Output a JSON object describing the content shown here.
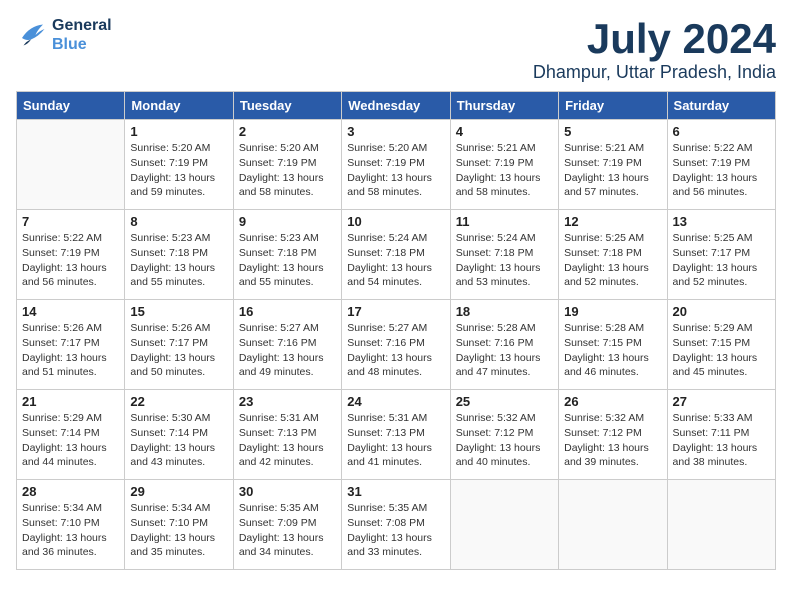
{
  "header": {
    "logo_line1": "General",
    "logo_line2": "Blue",
    "title": "July 2024",
    "subtitle": "Dhampur, Uttar Pradesh, India"
  },
  "columns": [
    "Sunday",
    "Monday",
    "Tuesday",
    "Wednesday",
    "Thursday",
    "Friday",
    "Saturday"
  ],
  "weeks": [
    [
      {
        "day": "",
        "info": ""
      },
      {
        "day": "1",
        "info": "Sunrise: 5:20 AM\nSunset: 7:19 PM\nDaylight: 13 hours\nand 59 minutes."
      },
      {
        "day": "2",
        "info": "Sunrise: 5:20 AM\nSunset: 7:19 PM\nDaylight: 13 hours\nand 58 minutes."
      },
      {
        "day": "3",
        "info": "Sunrise: 5:20 AM\nSunset: 7:19 PM\nDaylight: 13 hours\nand 58 minutes."
      },
      {
        "day": "4",
        "info": "Sunrise: 5:21 AM\nSunset: 7:19 PM\nDaylight: 13 hours\nand 58 minutes."
      },
      {
        "day": "5",
        "info": "Sunrise: 5:21 AM\nSunset: 7:19 PM\nDaylight: 13 hours\nand 57 minutes."
      },
      {
        "day": "6",
        "info": "Sunrise: 5:22 AM\nSunset: 7:19 PM\nDaylight: 13 hours\nand 56 minutes."
      }
    ],
    [
      {
        "day": "7",
        "info": "Sunrise: 5:22 AM\nSunset: 7:19 PM\nDaylight: 13 hours\nand 56 minutes."
      },
      {
        "day": "8",
        "info": "Sunrise: 5:23 AM\nSunset: 7:18 PM\nDaylight: 13 hours\nand 55 minutes."
      },
      {
        "day": "9",
        "info": "Sunrise: 5:23 AM\nSunset: 7:18 PM\nDaylight: 13 hours\nand 55 minutes."
      },
      {
        "day": "10",
        "info": "Sunrise: 5:24 AM\nSunset: 7:18 PM\nDaylight: 13 hours\nand 54 minutes."
      },
      {
        "day": "11",
        "info": "Sunrise: 5:24 AM\nSunset: 7:18 PM\nDaylight: 13 hours\nand 53 minutes."
      },
      {
        "day": "12",
        "info": "Sunrise: 5:25 AM\nSunset: 7:18 PM\nDaylight: 13 hours\nand 52 minutes."
      },
      {
        "day": "13",
        "info": "Sunrise: 5:25 AM\nSunset: 7:17 PM\nDaylight: 13 hours\nand 52 minutes."
      }
    ],
    [
      {
        "day": "14",
        "info": "Sunrise: 5:26 AM\nSunset: 7:17 PM\nDaylight: 13 hours\nand 51 minutes."
      },
      {
        "day": "15",
        "info": "Sunrise: 5:26 AM\nSunset: 7:17 PM\nDaylight: 13 hours\nand 50 minutes."
      },
      {
        "day": "16",
        "info": "Sunrise: 5:27 AM\nSunset: 7:16 PM\nDaylight: 13 hours\nand 49 minutes."
      },
      {
        "day": "17",
        "info": "Sunrise: 5:27 AM\nSunset: 7:16 PM\nDaylight: 13 hours\nand 48 minutes."
      },
      {
        "day": "18",
        "info": "Sunrise: 5:28 AM\nSunset: 7:16 PM\nDaylight: 13 hours\nand 47 minutes."
      },
      {
        "day": "19",
        "info": "Sunrise: 5:28 AM\nSunset: 7:15 PM\nDaylight: 13 hours\nand 46 minutes."
      },
      {
        "day": "20",
        "info": "Sunrise: 5:29 AM\nSunset: 7:15 PM\nDaylight: 13 hours\nand 45 minutes."
      }
    ],
    [
      {
        "day": "21",
        "info": "Sunrise: 5:29 AM\nSunset: 7:14 PM\nDaylight: 13 hours\nand 44 minutes."
      },
      {
        "day": "22",
        "info": "Sunrise: 5:30 AM\nSunset: 7:14 PM\nDaylight: 13 hours\nand 43 minutes."
      },
      {
        "day": "23",
        "info": "Sunrise: 5:31 AM\nSunset: 7:13 PM\nDaylight: 13 hours\nand 42 minutes."
      },
      {
        "day": "24",
        "info": "Sunrise: 5:31 AM\nSunset: 7:13 PM\nDaylight: 13 hours\nand 41 minutes."
      },
      {
        "day": "25",
        "info": "Sunrise: 5:32 AM\nSunset: 7:12 PM\nDaylight: 13 hours\nand 40 minutes."
      },
      {
        "day": "26",
        "info": "Sunrise: 5:32 AM\nSunset: 7:12 PM\nDaylight: 13 hours\nand 39 minutes."
      },
      {
        "day": "27",
        "info": "Sunrise: 5:33 AM\nSunset: 7:11 PM\nDaylight: 13 hours\nand 38 minutes."
      }
    ],
    [
      {
        "day": "28",
        "info": "Sunrise: 5:34 AM\nSunset: 7:10 PM\nDaylight: 13 hours\nand 36 minutes."
      },
      {
        "day": "29",
        "info": "Sunrise: 5:34 AM\nSunset: 7:10 PM\nDaylight: 13 hours\nand 35 minutes."
      },
      {
        "day": "30",
        "info": "Sunrise: 5:35 AM\nSunset: 7:09 PM\nDaylight: 13 hours\nand 34 minutes."
      },
      {
        "day": "31",
        "info": "Sunrise: 5:35 AM\nSunset: 7:08 PM\nDaylight: 13 hours\nand 33 minutes."
      },
      {
        "day": "",
        "info": ""
      },
      {
        "day": "",
        "info": ""
      },
      {
        "day": "",
        "info": ""
      }
    ]
  ]
}
